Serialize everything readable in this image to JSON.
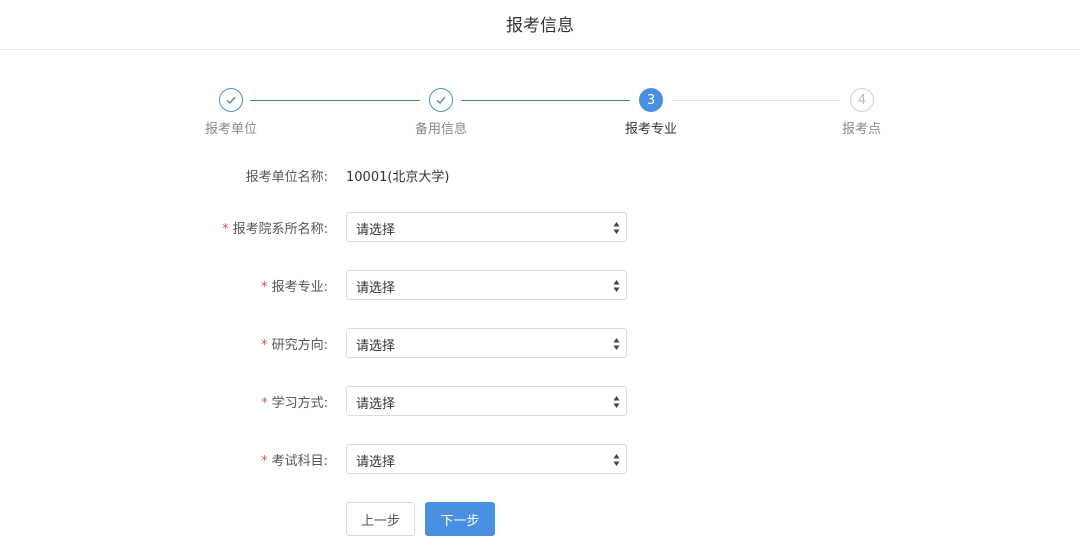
{
  "header": {
    "title": "报考信息"
  },
  "steps": [
    {
      "number": "1",
      "label": "报考单位",
      "status": "done"
    },
    {
      "number": "2",
      "label": "备用信息",
      "status": "done"
    },
    {
      "number": "3",
      "label": "报考专业",
      "status": "active"
    },
    {
      "number": "4",
      "label": "报考点",
      "status": "pending"
    }
  ],
  "form": {
    "unit": {
      "label": "报考单位名称:",
      "value": "10001(北京大学)"
    },
    "department": {
      "label": "报考院系所名称:",
      "value": "请选择",
      "required": "*"
    },
    "major": {
      "label": "报考专业:",
      "value": "请选择",
      "required": "*"
    },
    "direction": {
      "label": "研究方向:",
      "value": "请选择",
      "required": "*"
    },
    "study_mode": {
      "label": "学习方式:",
      "value": "请选择",
      "required": "*"
    },
    "subjects": {
      "label": "考试科目:",
      "value": "请选择",
      "required": "*"
    }
  },
  "buttons": {
    "prev": "上一步",
    "next": "下一步"
  },
  "colors": {
    "primary": "#4a90e2",
    "done": "#3f7fb5",
    "required": "#d9534f"
  },
  "icons": {
    "done_step": "check-icon",
    "select": "updown-arrow-icon"
  }
}
